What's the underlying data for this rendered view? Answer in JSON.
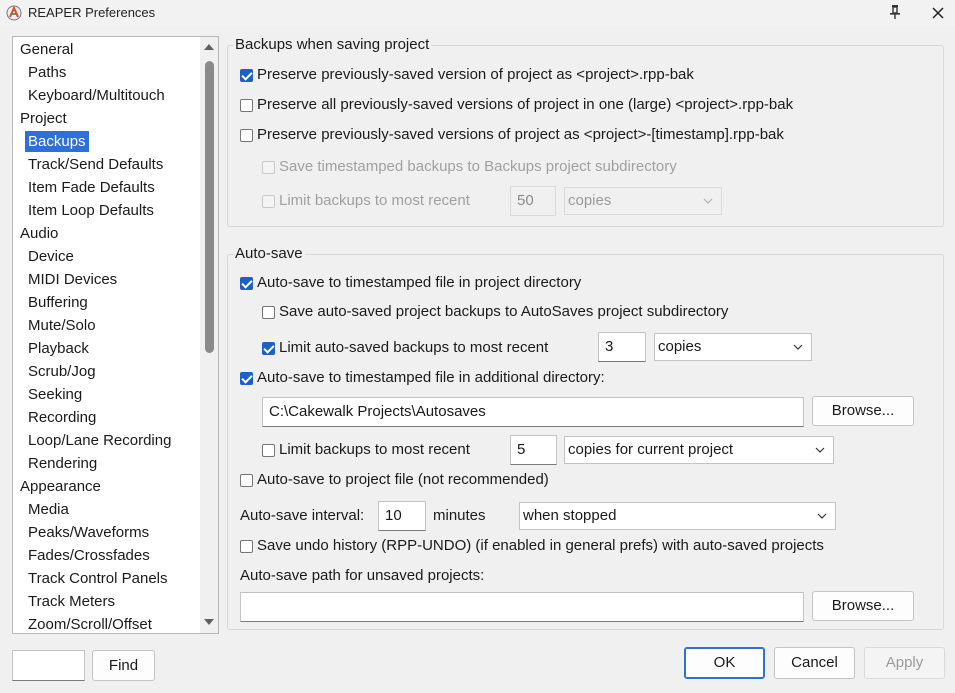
{
  "window": {
    "title": "REAPER Preferences"
  },
  "nav": {
    "items": [
      {
        "label": "General",
        "level": "cat"
      },
      {
        "label": "Paths",
        "level": "sub"
      },
      {
        "label": "Keyboard/Multitouch",
        "level": "sub"
      },
      {
        "label": "Project",
        "level": "cat"
      },
      {
        "label": "Backups",
        "level": "sub",
        "selected": true
      },
      {
        "label": "Track/Send Defaults",
        "level": "sub"
      },
      {
        "label": "Item Fade Defaults",
        "level": "sub"
      },
      {
        "label": "Item Loop Defaults",
        "level": "sub"
      },
      {
        "label": "Audio",
        "level": "cat"
      },
      {
        "label": "Device",
        "level": "sub"
      },
      {
        "label": "MIDI Devices",
        "level": "sub"
      },
      {
        "label": "Buffering",
        "level": "sub"
      },
      {
        "label": "Mute/Solo",
        "level": "sub"
      },
      {
        "label": "Playback",
        "level": "sub"
      },
      {
        "label": "Scrub/Jog",
        "level": "sub"
      },
      {
        "label": "Seeking",
        "level": "sub"
      },
      {
        "label": "Recording",
        "level": "sub"
      },
      {
        "label": "Loop/Lane Recording",
        "level": "sub"
      },
      {
        "label": "Rendering",
        "level": "sub"
      },
      {
        "label": "Appearance",
        "level": "cat"
      },
      {
        "label": "Media",
        "level": "sub"
      },
      {
        "label": "Peaks/Waveforms",
        "level": "sub"
      },
      {
        "label": "Fades/Crossfades",
        "level": "sub"
      },
      {
        "label": "Track Control Panels",
        "level": "sub"
      },
      {
        "label": "Track Meters",
        "level": "sub"
      },
      {
        "label": "Zoom/Scroll/Offset",
        "level": "sub"
      }
    ]
  },
  "backups": {
    "title": "Backups when saving project",
    "preserve_previous": {
      "label": "Preserve previously-saved version of project as <project>.rpp-bak",
      "checked": true
    },
    "preserve_all": {
      "label": "Preserve all previously-saved versions of project in one (large) <project>.rpp-bak",
      "checked": false
    },
    "preserve_timestamp": {
      "label": "Preserve previously-saved versions of project as <project>-[timestamp].rpp-bak",
      "checked": false
    },
    "timestamped_subdir": {
      "label": "Save timestamped backups to Backups project subdirectory",
      "checked": false
    },
    "limit": {
      "label": "Limit backups to most recent",
      "value": "50",
      "unit": "copies"
    }
  },
  "autosave": {
    "title": "Auto-save",
    "to_project_dir": {
      "label": "Auto-save to timestamped file in project directory",
      "checked": true
    },
    "autosaves_subdir": {
      "label": "Save auto-saved project backups to AutoSaves project subdirectory",
      "checked": false
    },
    "limit_autosaved": {
      "label": "Limit auto-saved backups to most recent",
      "checked": true,
      "value": "3",
      "unit": "copies"
    },
    "to_additional_dir": {
      "label": "Auto-save to timestamped file in additional directory:",
      "checked": true
    },
    "additional_path": "C:\\Cakewalk Projects\\Autosaves",
    "browse_label": "Browse...",
    "limit_additional": {
      "label": "Limit backups to most recent",
      "checked": false,
      "value": "5",
      "unit": "copies for current project"
    },
    "to_project_file": {
      "label": "Auto-save to project file (not recommended)",
      "checked": false
    },
    "interval_label": "Auto-save interval:",
    "interval_value": "10",
    "interval_unit": "minutes",
    "interval_mode": "when stopped",
    "undo_history": {
      "label": "Save undo history (RPP-UNDO) (if enabled in general prefs) with auto-saved projects",
      "checked": false
    },
    "unsaved_path_label": "Auto-save path for unsaved projects:",
    "unsaved_path": "",
    "browse2_label": "Browse..."
  },
  "footer": {
    "search_value": "",
    "find_label": "Find",
    "ok_label": "OK",
    "cancel_label": "Cancel",
    "apply_label": "Apply"
  },
  "colors": {
    "accent": "#2f6fd8",
    "checkbox": "#1b5fc9"
  }
}
